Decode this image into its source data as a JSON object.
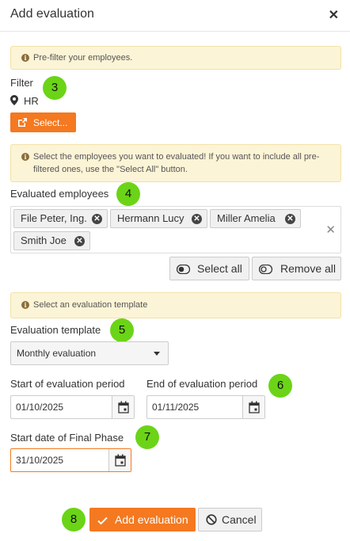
{
  "dialog": {
    "title": "Add evaluation",
    "close_glyph": "✕"
  },
  "alerts": {
    "prefilter": "Pre-filter your employees.",
    "select_employees": "Select the employees you want to evaluated! If you want to include all pre-filtered ones, use the \"Select All\" button.",
    "select_template": "Select an evaluation template"
  },
  "filter": {
    "label": "Filter",
    "value": "HR",
    "select_button": "Select..."
  },
  "employees": {
    "label": "Evaluated employees",
    "chips": [
      "File Peter, Ing.",
      "Hermann Lucy",
      "Miller Amelia",
      "Smith Joe"
    ],
    "select_all": "Select all",
    "remove_all": "Remove all"
  },
  "template": {
    "label": "Evaluation template",
    "value": "Monthly evaluation"
  },
  "period": {
    "start_label": "Start of evaluation period",
    "start_value": "01/10/2025",
    "end_label": "End of evaluation period",
    "end_value": "01/11/2025"
  },
  "final_phase": {
    "label": "Start date of Final Phase",
    "value": "31/10/2025"
  },
  "actions": {
    "add": "Add evaluation",
    "cancel": "Cancel"
  },
  "badges": [
    "3",
    "4",
    "5",
    "6",
    "7",
    "8"
  ],
  "colors": {
    "accent": "#f47920",
    "badge": "#6bd417",
    "alert_bg": "#fcf4d6"
  },
  "icons": [
    "close-icon",
    "info-icon",
    "map-pin-icon",
    "external-link-icon",
    "remove-chip-icon",
    "clear-icon",
    "toggle-on-icon",
    "toggle-off-icon",
    "chevron-down-icon",
    "calendar-icon",
    "check-icon",
    "ban-icon"
  ]
}
